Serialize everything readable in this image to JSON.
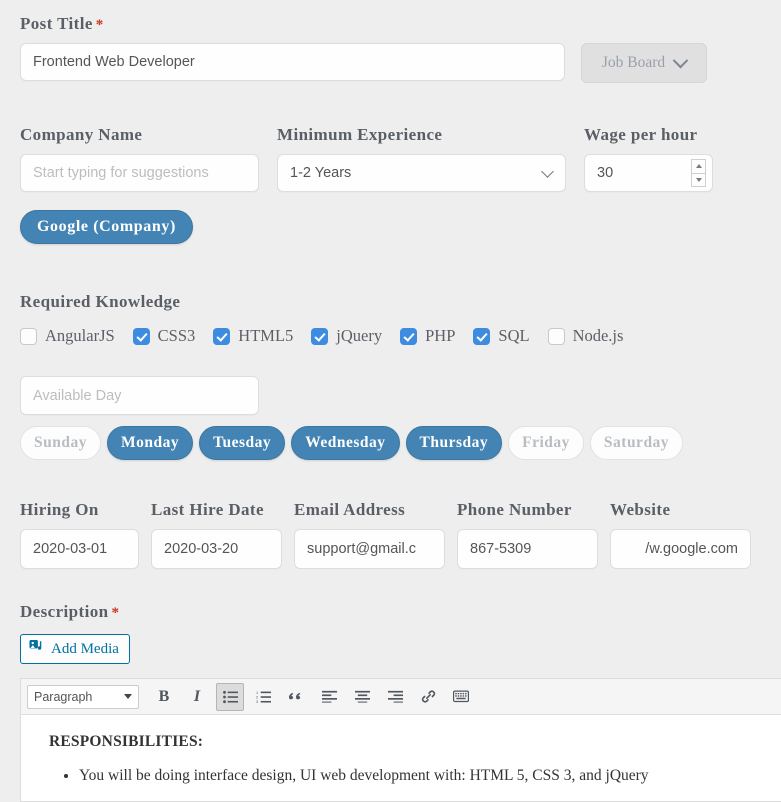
{
  "post_title": {
    "label": "Post Title",
    "required_mark": "*",
    "value": "Frontend Web Developer",
    "placeholder": "Post Title"
  },
  "job_board": {
    "label": "Job Board",
    "chevron_icon": "chevron-down-icon"
  },
  "company": {
    "label": "Company Name",
    "value": "",
    "placeholder": "Start typing for suggestions",
    "tag": "Google (Company)"
  },
  "experience": {
    "label": "Minimum Experience",
    "selected": "1-2 Years",
    "options": [
      "1-2 Years"
    ]
  },
  "wage": {
    "label": "Wage per hour",
    "value": "30",
    "increment_icon": "caret-up-icon",
    "decrement_icon": "caret-down-icon"
  },
  "knowledge": {
    "label": "Required Knowledge",
    "items": [
      {
        "label": "AngularJS",
        "checked": false
      },
      {
        "label": "CSS3",
        "checked": true
      },
      {
        "label": "HTML5",
        "checked": true
      },
      {
        "label": "jQuery",
        "checked": true
      },
      {
        "label": "PHP",
        "checked": true
      },
      {
        "label": "SQL",
        "checked": true
      },
      {
        "label": "Node.js",
        "checked": false
      }
    ]
  },
  "available_day": {
    "value": "",
    "placeholder": "Available Day",
    "days": [
      {
        "label": "Sunday",
        "selected": false
      },
      {
        "label": "Monday",
        "selected": true
      },
      {
        "label": "Tuesday",
        "selected": true
      },
      {
        "label": "Wednesday",
        "selected": true
      },
      {
        "label": "Thursday",
        "selected": true
      },
      {
        "label": "Friday",
        "selected": false
      },
      {
        "label": "Saturday",
        "selected": false
      }
    ]
  },
  "contact": {
    "hiring_on": {
      "label": "Hiring On",
      "value": "2020-03-01"
    },
    "last_hire_date": {
      "label": "Last Hire Date",
      "value": "2020-03-20"
    },
    "email": {
      "label": "Email Address",
      "value": "support@gmail.c"
    },
    "phone": {
      "label": "Phone Number",
      "value": "867-5309"
    },
    "website": {
      "label": "Website",
      "value": "/w.google.com"
    }
  },
  "description": {
    "label": "Description",
    "required_mark": "*",
    "add_media_label": "Add Media",
    "add_media_icon": "media-icon"
  },
  "editor": {
    "format_selected": "Paragraph",
    "toolbar": [
      {
        "name": "bold-icon",
        "glyph": "B",
        "active": false
      },
      {
        "name": "italic-icon",
        "glyph": "I",
        "active": false
      },
      {
        "name": "bulleted-list-icon",
        "glyph": "",
        "active": true
      },
      {
        "name": "numbered-list-icon",
        "glyph": "",
        "active": false
      },
      {
        "name": "blockquote-icon",
        "glyph": "“",
        "active": false
      },
      {
        "name": "align-left-icon",
        "glyph": "",
        "active": false
      },
      {
        "name": "align-center-icon",
        "glyph": "",
        "active": false
      },
      {
        "name": "align-right-icon",
        "glyph": "",
        "active": false
      },
      {
        "name": "insert-link-icon",
        "glyph": "",
        "active": false
      },
      {
        "name": "keyboard-shortcuts-icon",
        "glyph": "",
        "active": false
      }
    ],
    "content": {
      "heading": "RESPONSIBILITIES:",
      "bullets": [
        "You will be doing interface design, UI web development with: HTML 5, CSS 3, and jQuery"
      ]
    }
  },
  "colors": {
    "accent_blue": "#4384b5",
    "checkbox_blue": "#3d8cdf",
    "link_blue": "#0071a1",
    "required_red": "#cc3322",
    "page_bg": "#eeeeee"
  }
}
